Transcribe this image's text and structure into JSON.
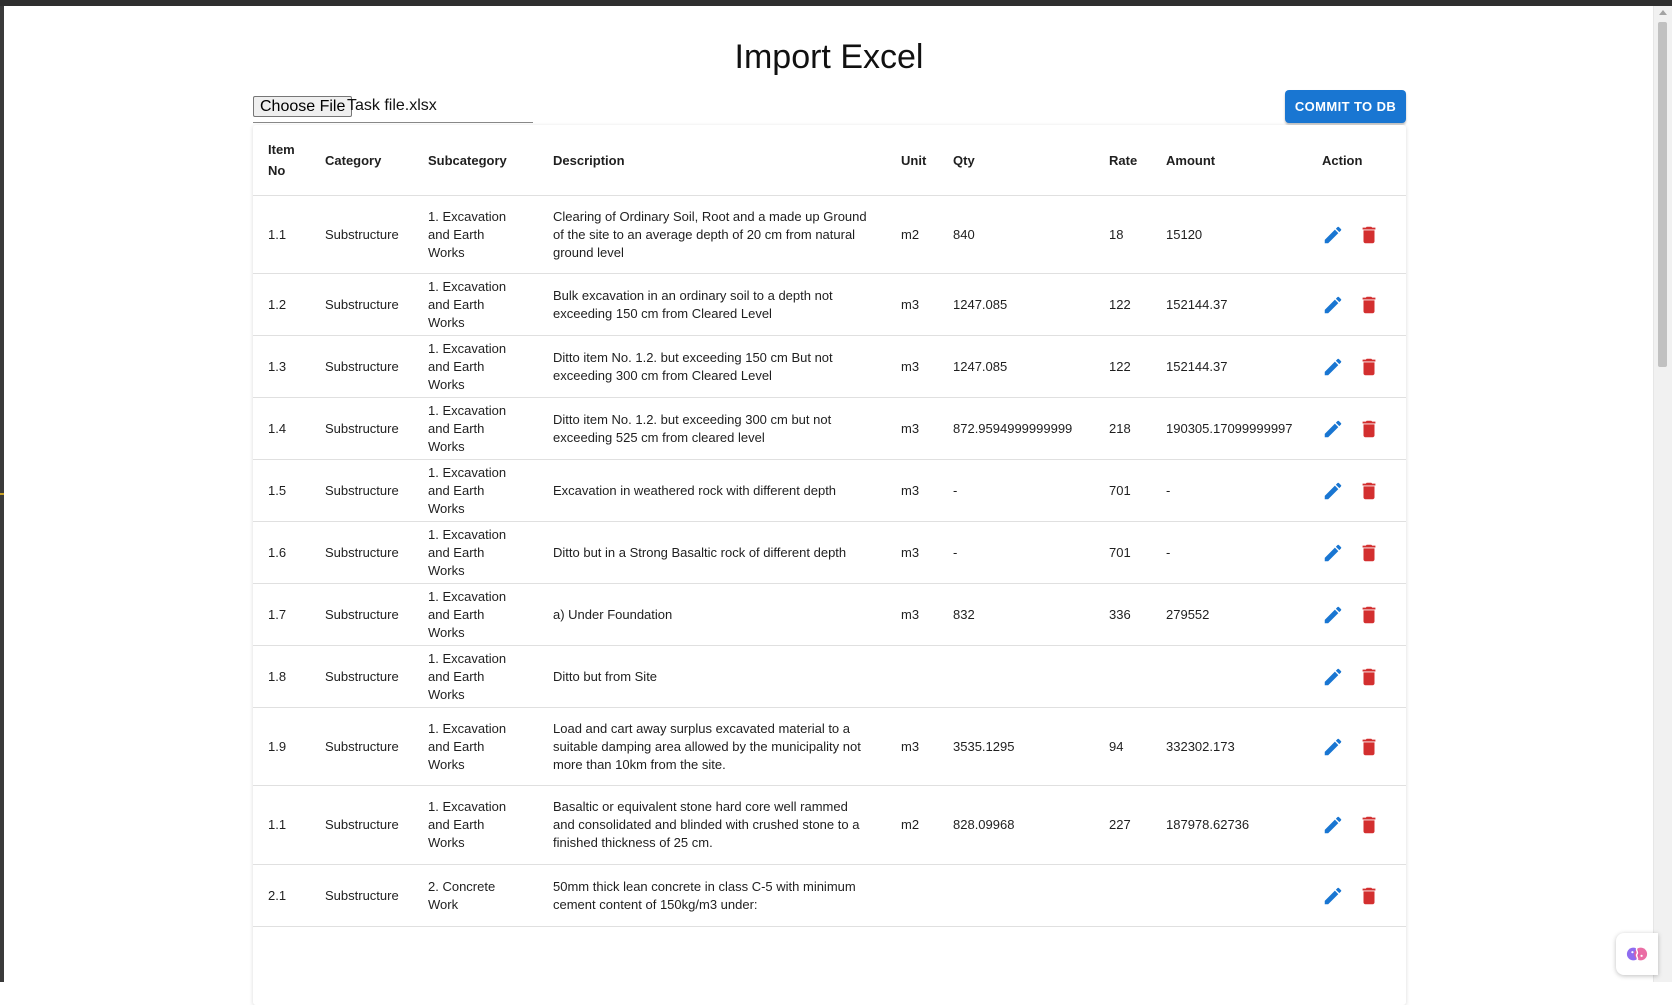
{
  "page_title": "Import Excel",
  "file_input": {
    "button_label": "Choose File",
    "file_name": "Task file.xlsx"
  },
  "commit_button": "COMMIT TO DB",
  "table": {
    "headers": {
      "item_no": "Item No",
      "category": "Category",
      "subcategory": "Subcategory",
      "description": "Description",
      "unit": "Unit",
      "qty": "Qty",
      "rate": "Rate",
      "amount": "Amount",
      "action": "Action"
    },
    "rows": [
      {
        "item_no": "1.1",
        "category": "Substructure",
        "subcategory": "1. Excavation and Earth Works",
        "description": "Clearing of Ordinary Soil, Root and a made up Ground of the site to an average depth of 20 cm from natural ground level",
        "unit": "m2",
        "qty": "840",
        "rate": "18",
        "amount": "15120"
      },
      {
        "item_no": "1.2",
        "category": "Substructure",
        "subcategory": "1. Excavation and Earth Works",
        "description": "Bulk excavation in an ordinary soil to a depth not exceeding 150 cm from Cleared Level",
        "unit": "m3",
        "qty": "1247.085",
        "rate": "122",
        "amount": "152144.37"
      },
      {
        "item_no": "1.3",
        "category": "Substructure",
        "subcategory": "1. Excavation and Earth Works",
        "description": "Ditto item No. 1.2. but exceeding 150 cm But not exceeding 300 cm from Cleared Level",
        "unit": "m3",
        "qty": "1247.085",
        "rate": "122",
        "amount": "152144.37"
      },
      {
        "item_no": "1.4",
        "category": "Substructure",
        "subcategory": "1. Excavation and Earth Works",
        "description": "Ditto item No. 1.2. but exceeding 300 cm but not exceeding 525 cm from cleared level",
        "unit": "m3",
        "qty": "872.9594999999999",
        "rate": "218",
        "amount": "190305.17099999997"
      },
      {
        "item_no": "1.5",
        "category": "Substructure",
        "subcategory": "1. Excavation and Earth Works",
        "description": "Excavation in weathered rock with different depth",
        "unit": "m3",
        "qty": "-",
        "rate": "701",
        "amount": "-"
      },
      {
        "item_no": "1.6",
        "category": "Substructure",
        "subcategory": "1. Excavation and Earth Works",
        "description": "Ditto but in a Strong Basaltic rock of different depth",
        "unit": "m3",
        "qty": "-",
        "rate": "701",
        "amount": "-"
      },
      {
        "item_no": "1.7",
        "category": "Substructure",
        "subcategory": "1. Excavation and Earth Works",
        "description": "a) Under Foundation",
        "unit": "m3",
        "qty": "832",
        "rate": "336",
        "amount": "279552"
      },
      {
        "item_no": "1.8",
        "category": "Substructure",
        "subcategory": "1. Excavation and Earth Works",
        "description": "Ditto but from Site",
        "unit": "",
        "qty": "",
        "rate": "",
        "amount": ""
      },
      {
        "item_no": "1.9",
        "category": "Substructure",
        "subcategory": "1. Excavation and Earth Works",
        "description": "Load and cart away surplus excavated material to a suitable damping area allowed by the municipality not more than 10km from the site.",
        "unit": "m3",
        "qty": "3535.1295",
        "rate": "94",
        "amount": "332302.173"
      },
      {
        "item_no": "1.1",
        "category": "Substructure",
        "subcategory": "1. Excavation and Earth Works",
        "description": "Basaltic or equivalent stone hard core well rammed and consolidated and blinded with crushed stone to a finished thickness of 25 cm.",
        "unit": "m2",
        "qty": "828.09968",
        "rate": "227",
        "amount": "187978.62736"
      },
      {
        "item_no": "2.1",
        "category": "Substructure",
        "subcategory": "2. Concrete Work",
        "description": "50mm thick lean concrete in class C-5 with minimum cement content of 150kg/m3 under:",
        "unit": "",
        "qty": "",
        "rate": "",
        "amount": ""
      }
    ]
  },
  "icons": {
    "edit": "pencil-icon",
    "delete": "trash-icon"
  },
  "colors": {
    "primary": "#1976d2",
    "danger": "#d32f2f"
  }
}
